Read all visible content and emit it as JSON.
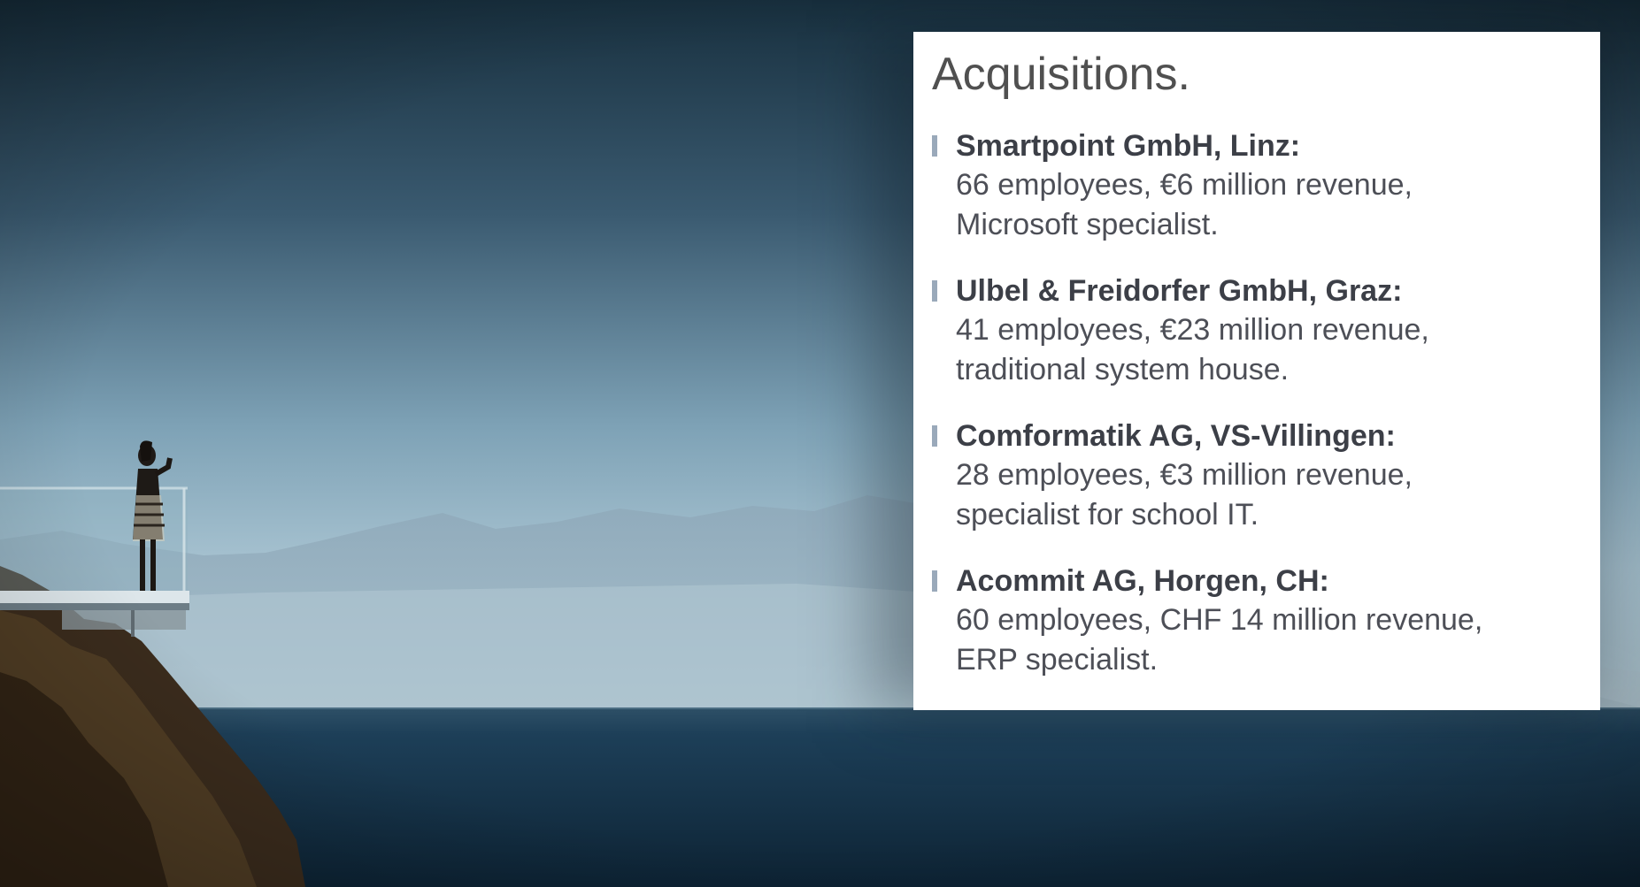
{
  "slide": {
    "title": "Acquisitions.",
    "items": [
      {
        "name": "Smartpoint GmbH, Linz:",
        "line1": "66 employees, €6 million revenue,",
        "line2": "Microsoft specialist."
      },
      {
        "name": "Ulbel & Freidorfer GmbH, Graz:",
        "line1": "41 employees, €23 million revenue,",
        "line2": "traditional system house."
      },
      {
        "name": "Comformatik AG, VS-Villingen:",
        "line1": "28 employees, €3 million revenue,",
        "line2": "specialist for school IT."
      },
      {
        "name": "Acommit AG, Horgen, CH:",
        "line1": "60 employees, CHF 14 million revenue,",
        "line2": "ERP specialist."
      }
    ]
  },
  "colors": {
    "sky_top": "#1b3447",
    "sky_horizon": "#98b7c8",
    "sea": "#123049",
    "bullet": "#9aa9ba",
    "text": "#4d4f57"
  }
}
